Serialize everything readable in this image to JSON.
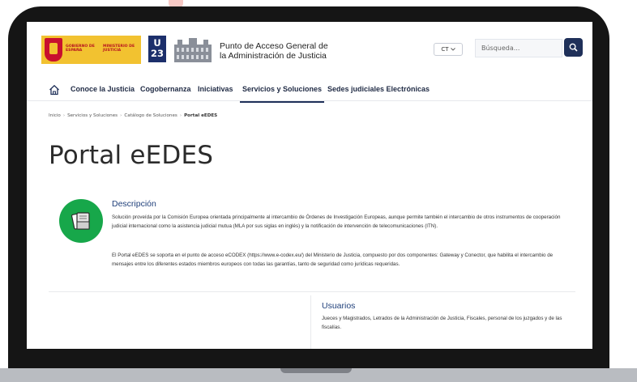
{
  "header": {
    "gobierno_label": "GOBIERNO DE ESPAÑA",
    "ministerio_label": "MINISTERIO DE JUSTICIA",
    "u23_label": "U 23",
    "portal_title_line1": "Punto de Acceso General de",
    "portal_title_line2": "la Administración de Justicia",
    "language": "CT",
    "search_placeholder": "Búsqueda...",
    "brand_color": "#1f3059"
  },
  "nav": {
    "items": [
      {
        "label": "Conoce la Justicia"
      },
      {
        "label": "Cogobernanza"
      },
      {
        "label": "Iniciativas"
      },
      {
        "label": "Servicios y Soluciones"
      },
      {
        "label": "Sedes judiciales Electrónicas"
      }
    ],
    "active": "Servicios y Soluciones"
  },
  "breadcrumb": {
    "items": [
      "Inicio",
      "Servicios y Soluciones",
      "Catálogo de Soluciones",
      "Portal eEDES"
    ]
  },
  "page": {
    "title": "Portal eEDES",
    "accent_color": "#17a74a",
    "description": {
      "heading": "Descripción",
      "paragraph1": "Solución proveída por la Comisión Europea orientada principalmente al intercambio de Órdenes de Investigación Europeas, aunque permite también el intercambio de otros instrumentos de cooperación judicial internacional como la asistencia judicial mutua (MLA por sus siglas en inglés) y la notificación de intervención de telecomunicaciones (ITN).",
      "paragraph2": "El Portal eEDES se soporta en el punto de acceso eCODEX (https://www.e-codex.eu/) del Ministerio de Justicia, compuesto por dos componentes: Gateway y Conector, que habilita el intercambio de mensajes entre los diferentes estados miembros europeos con todas las garantías, tanto de seguridad como jurídicas requeridas."
    },
    "users": {
      "heading": "Usuarios",
      "text": "Jueces y Magistrados, Letrados de la Administración de Justicia, Fiscales, personal de los juzgados y de las fiscalías."
    }
  }
}
